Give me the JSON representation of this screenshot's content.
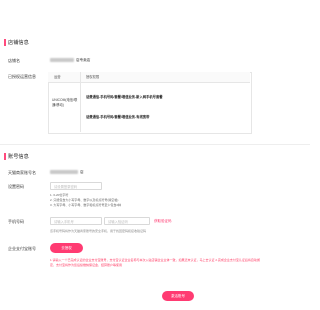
{
  "store_info": {
    "section_title": "店铺信息",
    "store_name_label": "店铺名",
    "store_name_suffix": "店专卖店",
    "authorized_label": "已授权运营信息",
    "table_headers": [
      "运营",
      "授权权限"
    ],
    "operator_name": "UNICOM(电信/联通/移动)",
    "row1": "话费通信-手机号码/套餐/增值业务-新入网手机号套餐",
    "row2": "话费通信-手机号码/套餐/增值业务-有线宽带"
  },
  "account_info": {
    "section_title": "账号信息",
    "merchant_label": "天猫商家账号名",
    "merchant_suffix": "店",
    "password_label": "设置密码",
    "password_placeholder": "请设置登录密码",
    "password_hints": [
      "1. 6-20位字符",
      "2. 只能包含大小写字母、数字以及标点符号(除空格)",
      "3. 大写字母、小写字母、数字和标点符号至少包含2种"
    ],
    "phone_label": "手机号码",
    "phone_placeholder": "请输入手机号",
    "code_placeholder": "请输入验证码",
    "get_code_label": "获取验证码",
    "phone_note": "该手机号码将作为天猫商家账号的安全手机，用于找回密码和接收验证码",
    "pay_label": "企业支付宝账号",
    "pay_button": "去授权",
    "pay_note": "1.请输入一个已完成认证的企业支付宝账号，支付宝认证企业名称与本次入驻店铺企业主体一致，如果还未认证，马上去认证  2.完成企业支付宝认证后将自动绑定，支付宝将作为您后续缴纳保证金、结算账户等使用"
  },
  "submit_label": "激活账号",
  "colors": {
    "accent": "#ff3b72"
  }
}
